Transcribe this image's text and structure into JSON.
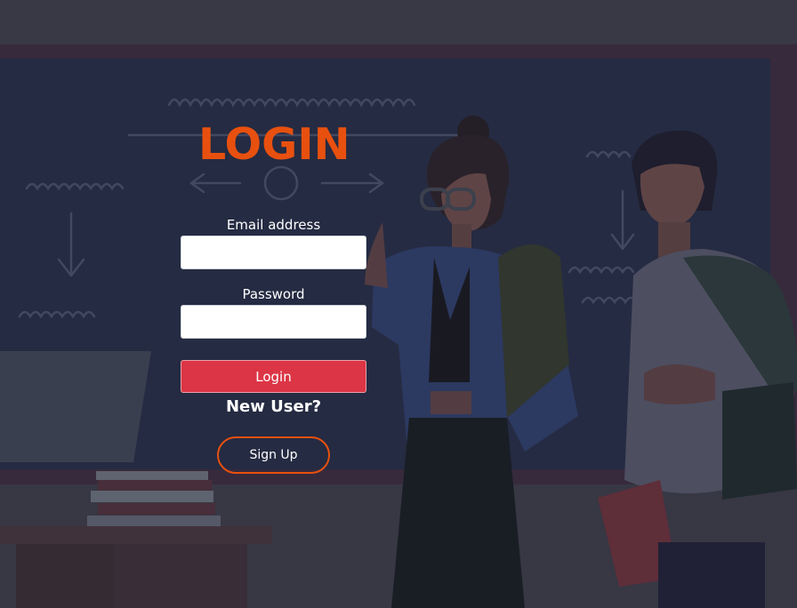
{
  "title": "LOGIN",
  "form": {
    "email_label": "Email address",
    "email_value": "",
    "password_label": "Password",
    "password_value": "",
    "login_button": "Login",
    "new_user_text": "New User?",
    "signup_button": "Sign Up"
  },
  "colors": {
    "title": "#e8500f",
    "login_button": "#dc3545",
    "signup_border": "#e8500f",
    "overlay": "#3c3b48"
  }
}
